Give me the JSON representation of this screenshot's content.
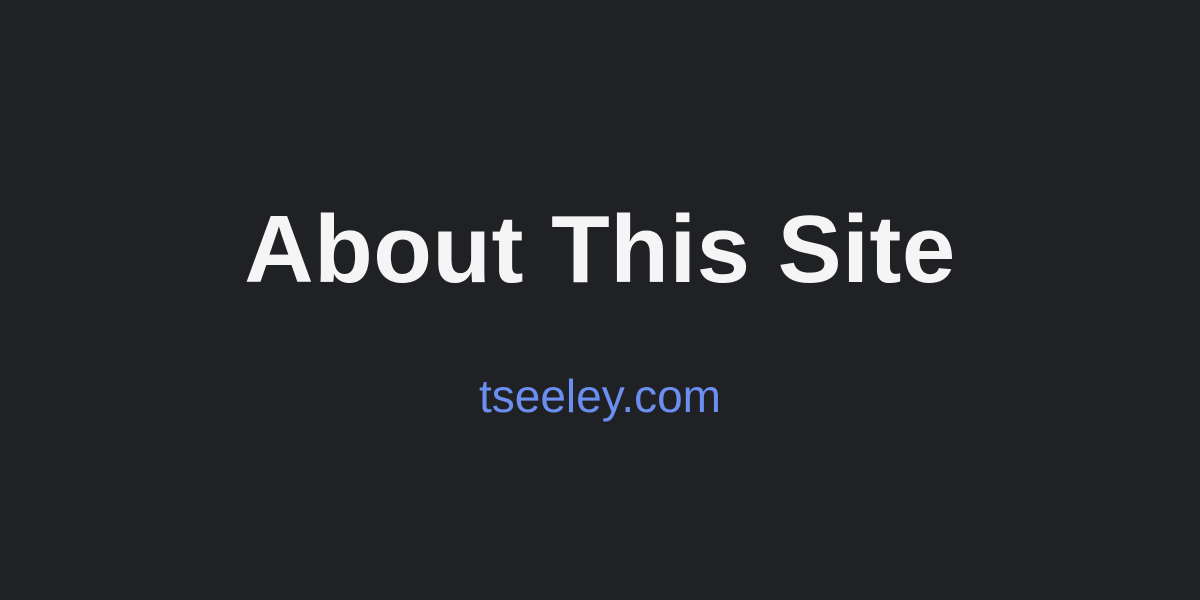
{
  "card": {
    "title": "About This Site",
    "site": "tseeley.com"
  },
  "colors": {
    "background": "#202124",
    "title": "#f5f5f5",
    "site": "#6b8ff0"
  }
}
